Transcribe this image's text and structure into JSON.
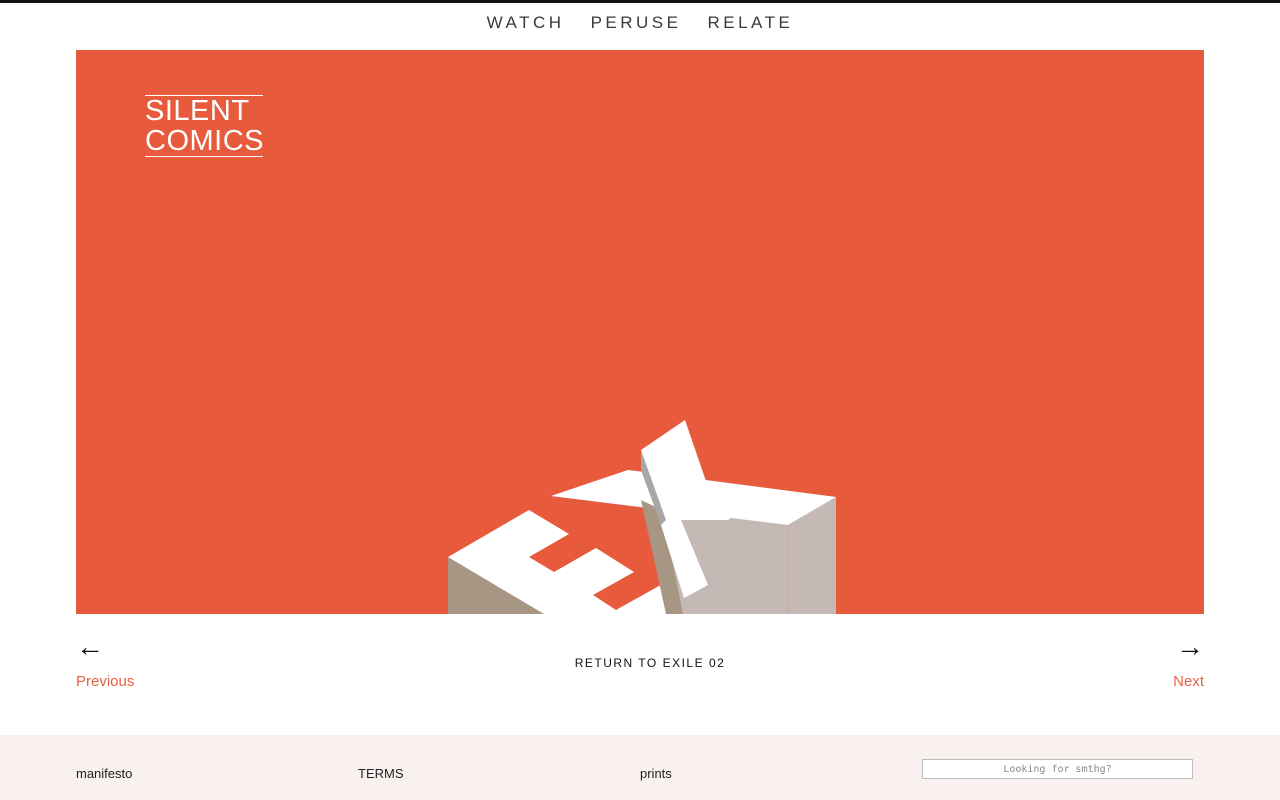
{
  "nav": {
    "items": [
      {
        "label": "WATCH"
      },
      {
        "label": "PERUSE"
      },
      {
        "label": "RELATE"
      }
    ]
  },
  "hero": {
    "background": "#e85a3c",
    "logo": {
      "line1": "SILENT",
      "line2": "COMICS"
    },
    "artwork_text": "EX"
  },
  "pager": {
    "prev_arrow": "←",
    "next_arrow": "→",
    "prev_label": "Previous",
    "next_label": "Next",
    "return_label": "RETURN TO EXILE 02"
  },
  "footer": {
    "links": [
      {
        "label": "manifesto"
      },
      {
        "label": "TERMS"
      },
      {
        "label": "prints"
      }
    ],
    "search_placeholder": "Looking for smthg?"
  },
  "colors": {
    "accent": "#e85a3c",
    "link_accent": "#e8614a",
    "footer_bg": "#f8f1f0"
  }
}
